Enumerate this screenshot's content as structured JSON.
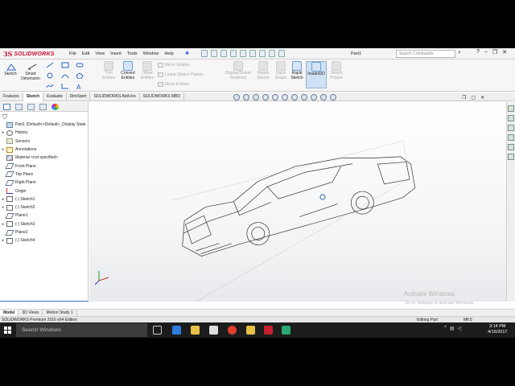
{
  "app": {
    "logo_text": "SOLIDWORKS",
    "document_name": "Part1",
    "search_placeholder": "Search Commands",
    "menu": [
      "File",
      "Edit",
      "View",
      "Insert",
      "Tools",
      "Window",
      "Help"
    ]
  },
  "toolbar": {
    "tools": [
      {
        "label": "Sketch",
        "state": "on"
      },
      {
        "label": "Smart Dimension",
        "state": "on"
      },
      {
        "label": "Trim Entities",
        "state": "disabled"
      },
      {
        "label": "Convert Entities",
        "state": "on"
      },
      {
        "label": "Offset Entities",
        "state": "disabled"
      },
      {
        "label": "Display/Delete Relations",
        "state": "disabled"
      },
      {
        "label": "Repair Sketch",
        "state": "disabled"
      },
      {
        "label": "Quick Snaps",
        "state": "disabled"
      },
      {
        "label": "Rapid Sketch",
        "state": "on"
      },
      {
        "label": "Instant2D",
        "state": "selected"
      },
      {
        "label": "Sketch Picture",
        "state": "disabled"
      }
    ],
    "mirror_label": "Mirror Entities",
    "pattern_label": "Linear Sketch Pattern",
    "move_label": "Move Entities"
  },
  "tabs": [
    "Features",
    "Sketch",
    "Evaluate",
    "DimXpert",
    "SOLIDWORKS Add-Ins",
    "SOLIDWORKS MBD"
  ],
  "active_tab": "Sketch",
  "tree": [
    {
      "label": "Part1  (Default<<Default>_Display State",
      "icon": "part",
      "expand": ""
    },
    {
      "label": "History",
      "icon": "hist",
      "expand": "▸"
    },
    {
      "label": "Sensors",
      "icon": "sens",
      "expand": ""
    },
    {
      "label": "Annotations",
      "icon": "ann",
      "expand": "▸"
    },
    {
      "label": "Material <not specified>",
      "icon": "mat",
      "expand": ""
    },
    {
      "label": "Front Plane",
      "icon": "plane",
      "expand": ""
    },
    {
      "label": "Top Plane",
      "icon": "plane",
      "expand": ""
    },
    {
      "label": "Right Plane",
      "icon": "plane",
      "expand": ""
    },
    {
      "label": "Origin",
      "icon": "origin",
      "expand": ""
    },
    {
      "label": "(-) Sketch1",
      "icon": "sketch",
      "expand": "▸"
    },
    {
      "label": "(-) Sketch2",
      "icon": "sketch",
      "expand": "▸"
    },
    {
      "label": "Plane1",
      "icon": "plane",
      "expand": ""
    },
    {
      "label": "(-) Sketch3",
      "icon": "sketch",
      "expand": "▸"
    },
    {
      "label": "Plane2",
      "icon": "plane",
      "expand": ""
    },
    {
      "label": "(-) Sketch4",
      "icon": "sketch",
      "expand": "▸"
    }
  ],
  "bottom_tabs": [
    "Model",
    "3D Views",
    "Motion Study 1"
  ],
  "watermark": {
    "title": "Activate Windows",
    "subtitle": "Go to Settings to activate Windows."
  },
  "status": {
    "left": "SOLIDWORKS Premium 2016 x64 Edition",
    "mode": "Editing Part",
    "units": "MKS"
  },
  "taskbar": {
    "search": "Search Windows",
    "time": "3:14 PM",
    "date": "4/16/2017"
  }
}
